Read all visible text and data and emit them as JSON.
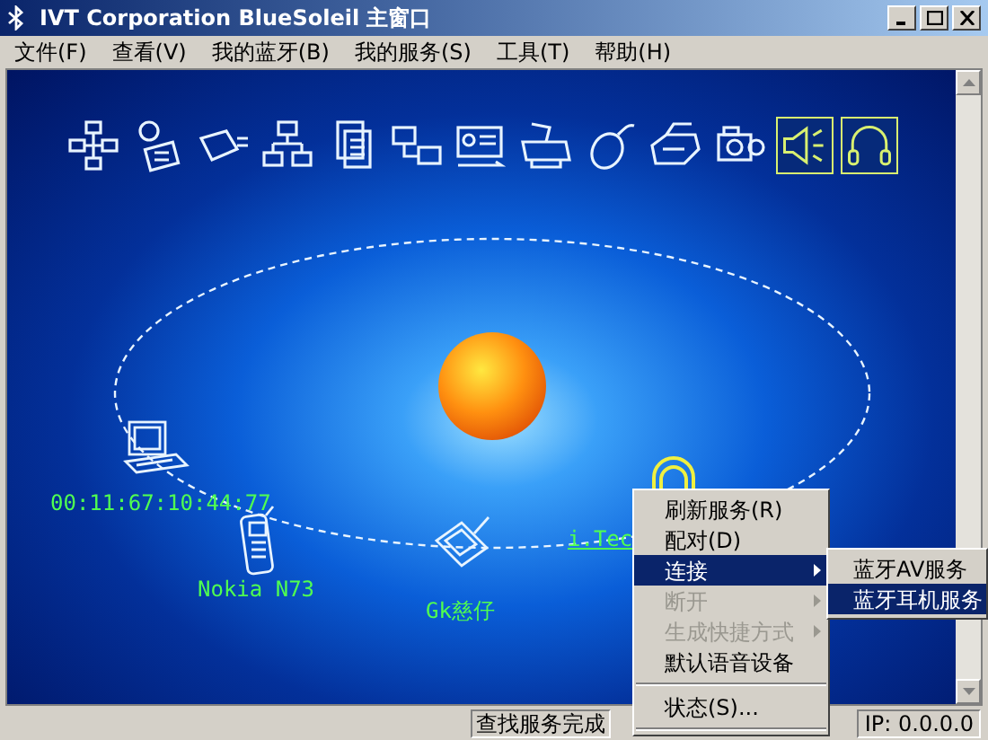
{
  "window": {
    "title": "IVT Corporation BlueSoleil 主窗口"
  },
  "menu_bar": [
    "文件(F)",
    "查看(V)",
    "我的蓝牙(B)",
    "我的服务(S)",
    "工具(T)",
    "帮助(H)"
  ],
  "service_icons": [
    {
      "kind": "network",
      "highlighted": false
    },
    {
      "kind": "dialup",
      "highlighted": false
    },
    {
      "kind": "serial",
      "highlighted": false
    },
    {
      "kind": "lan",
      "highlighted": false
    },
    {
      "kind": "file",
      "highlighted": false
    },
    {
      "kind": "sync",
      "highlighted": false
    },
    {
      "kind": "card",
      "highlighted": false
    },
    {
      "kind": "printer",
      "highlighted": false
    },
    {
      "kind": "mouse",
      "highlighted": false
    },
    {
      "kind": "fax",
      "highlighted": false
    },
    {
      "kind": "camera",
      "highlighted": false
    },
    {
      "kind": "speaker",
      "highlighted": true
    },
    {
      "kind": "headset",
      "highlighted": true
    }
  ],
  "devices": [
    {
      "kind": "laptop",
      "label": "00:11:67:10:44:77"
    },
    {
      "kind": "phone",
      "label": "Nokia N73"
    },
    {
      "kind": "pda",
      "label": "Gk慈仔"
    },
    {
      "kind": "headset",
      "label": "i.Tec"
    }
  ],
  "context_menu": [
    {
      "label": "刷新服务(R)",
      "selected": false,
      "disabled": false,
      "submenu": false
    },
    {
      "label": "配对(D)",
      "selected": false,
      "disabled": false,
      "submenu": false
    },
    {
      "label": "连接",
      "selected": true,
      "disabled": false,
      "submenu": true
    },
    {
      "label": "断开",
      "selected": false,
      "disabled": true,
      "submenu": true
    },
    {
      "label": "生成快捷方式",
      "selected": false,
      "disabled": true,
      "submenu": true
    },
    {
      "label": "默认语音设备",
      "selected": false,
      "disabled": false,
      "submenu": false
    },
    {
      "label": "状态(S)...",
      "selected": false,
      "disabled": false,
      "submenu": false
    }
  ],
  "submenu": [
    {
      "label": "蓝牙AV服务",
      "selected": false
    },
    {
      "label": "蓝牙耳机服务",
      "selected": true
    }
  ],
  "status_bar": {
    "message": "查找服务完成",
    "ip": "IP: 0.0.0.0"
  }
}
